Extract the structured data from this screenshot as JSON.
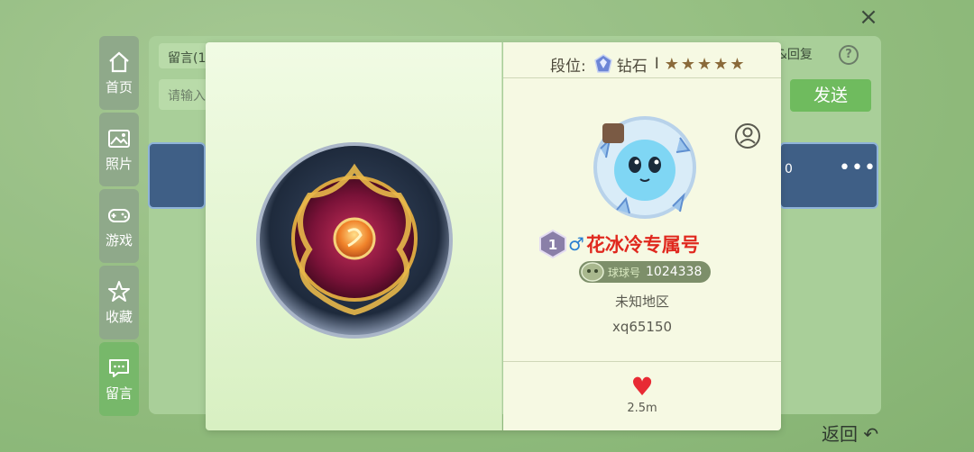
{
  "close_label": "×",
  "nav": {
    "items": [
      {
        "label": "首页",
        "icon": "home-icon"
      },
      {
        "label": "照片",
        "icon": "photo-icon"
      },
      {
        "label": "游戏",
        "icon": "gamepad-icon"
      },
      {
        "label": "收藏",
        "icon": "star-icon"
      },
      {
        "label": "留言",
        "icon": "message-icon"
      }
    ],
    "active_index": 4
  },
  "background": {
    "tab_label": "留言(1",
    "input_placeholder": "请输入",
    "reply_link": "&回复",
    "help_label": "?",
    "send_label": "发送",
    "card_likes": "0",
    "card_more": "•••",
    "back_label": "返回"
  },
  "profile": {
    "rank_label": "段位:",
    "rank_name": "钻石",
    "rank_tier": "I",
    "stars": 5,
    "level": "1",
    "gender_symbol": "♂",
    "nickname": "花冰冷专属号",
    "id_tag": "球球号",
    "id_number": "1024338",
    "region": "未知地区",
    "account": "xq65150",
    "likes": "2.5m"
  },
  "colors": {
    "nickname": "#e0281e",
    "gender": "#2a7fd1",
    "send_button": "#6fbb5e",
    "heart": "#e82a34"
  }
}
